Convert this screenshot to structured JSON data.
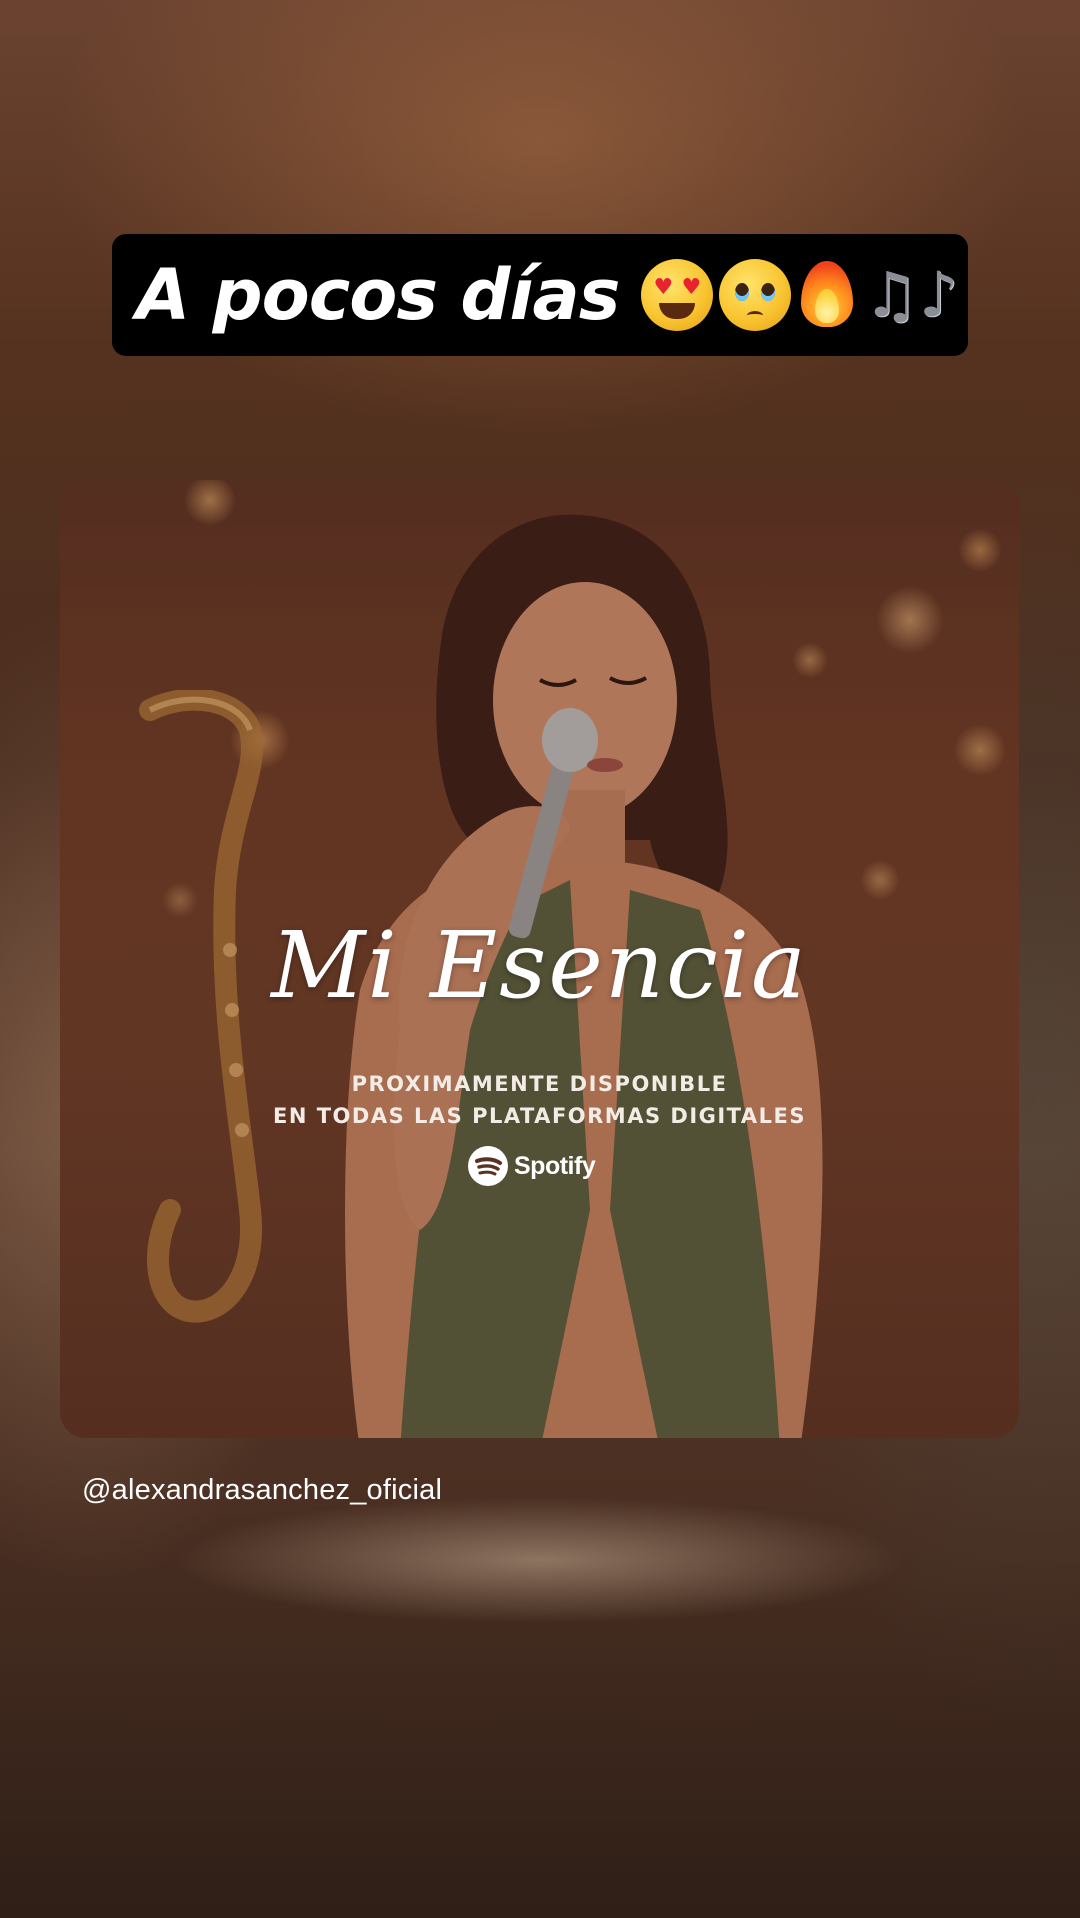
{
  "story": {
    "headline": "A pocos días",
    "headline_emojis": [
      "heart-eyes-emoji",
      "pleading-teary-emoji",
      "fire-emoji",
      "musical-notes-emoji"
    ],
    "mention": "@alexandrasanchez_oficial"
  },
  "album_card": {
    "title": "Mi Esencia",
    "subtitle_line1": "PROXIMAMENTE DISPONIBLE",
    "subtitle_line2": "EN TODAS LAS PLATAFORMAS DIGITALES",
    "platform": "Spotify",
    "platform_icon": "spotify-icon"
  },
  "colors": {
    "headline_bg": "#000000",
    "text": "#ffffff"
  }
}
